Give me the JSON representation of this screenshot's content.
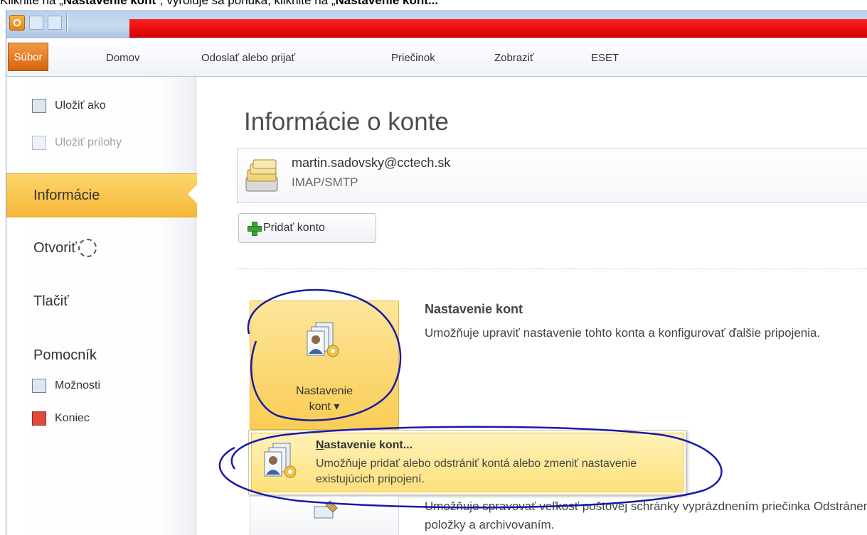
{
  "caption": {
    "pre": "Kliknite na „",
    "bold1": "Nastavenie kont",
    "mid": "“, vyroluje sa ponuka, kliknite na „",
    "bold2": "Nastavenie kont..."
  },
  "app": {
    "app_icon_letter": "O"
  },
  "ribbon": {
    "tabs": [
      {
        "label": "Súbor"
      },
      {
        "label": "Domov"
      },
      {
        "label": "Odoslať alebo prijať"
      },
      {
        "label": "Priečinok"
      },
      {
        "label": "Zobraziť"
      },
      {
        "label": "ESET"
      }
    ]
  },
  "sidebar": {
    "save_as": "Uložiť ako",
    "save_attachments": "Uložiť prílohy",
    "info": "Informácie",
    "open": "Otvoriť",
    "print": "Tlačiť",
    "help": "Pomocník",
    "options": "Možnosti",
    "exit": "Koniec"
  },
  "main": {
    "title": "Informácie o konte",
    "account": {
      "email": "martin.sadovsky@cctech.sk",
      "type": "IMAP/SMTP"
    },
    "add_account": "Pridať konto",
    "account_settings": {
      "button_line1": "Nastavenie",
      "button_line2": "kont",
      "button_caret": "▾",
      "title": "Nastavenie kont",
      "description": "Umožňuje upraviť nastavenie tohto konta a konfigurovať ďalšie pripojenia."
    },
    "dropdown": {
      "title_accel": "N",
      "title_rest": "astavenie kont...",
      "description": "Umožňuje pridať alebo odstrániť kontá alebo zmeniť nastavenie existujúcich pripojení."
    },
    "cleanup": {
      "description": "Umožňuje spravovať veľkosť poštovej schránky vyprázdnením priečinka Odstránené položky a archivovaním."
    }
  },
  "colors": {
    "file_tab": "#e3731a",
    "active_side": "#f9c64c",
    "title_red": "#e00000",
    "annotation": "#1a1aa8"
  }
}
